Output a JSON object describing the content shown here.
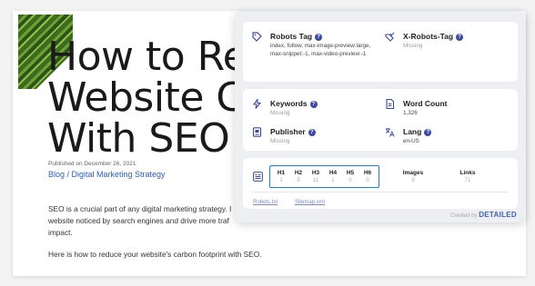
{
  "article": {
    "title_lines": [
      "How to Red",
      "Website Ca",
      "With SEO"
    ],
    "published": "Published on December 26, 2021",
    "breadcrumb": "Blog / Digital Marketing Strategy",
    "paragraph1_lines": [
      "SEO is a crucial part of any digital marketing strategy. I",
      "website noticed by search engines and drive more traf",
      "impact."
    ],
    "paragraph2": "Here is how to reduce your website's carbon footprint with SEO."
  },
  "panel": {
    "robots": {
      "label": "Robots Tag",
      "value": "index, follow, max-image-preview:large, max-snippet:-1, max-video-preview:-1",
      "icon": "tag-icon"
    },
    "x_robots": {
      "label": "X-Robots-Tag",
      "value": "Missing",
      "icon": "tag-check-icon"
    },
    "keywords": {
      "label": "Keywords",
      "value": "Missing",
      "icon": "bolt-icon"
    },
    "word_count": {
      "label": "Word Count",
      "value": "1,326",
      "icon": "document-icon"
    },
    "publisher": {
      "label": "Publisher",
      "value": "Missing",
      "icon": "badge-icon"
    },
    "lang": {
      "label": "Lang",
      "value": "en-US",
      "icon": "translate-icon"
    },
    "headings": [
      {
        "label": "H1",
        "value": "1"
      },
      {
        "label": "H2",
        "value": "5"
      },
      {
        "label": "H3",
        "value": "11"
      },
      {
        "label": "H4",
        "value": "1"
      },
      {
        "label": "H5",
        "value": "0"
      },
      {
        "label": "H6",
        "value": "0"
      }
    ],
    "images": {
      "label": "Images",
      "value": "9"
    },
    "links": {
      "label": "Links",
      "value": "71"
    },
    "robots_link": "Robots.txt",
    "sitemap_link": "Sitemap.xml",
    "credit_prefix": "Created by",
    "credit_brand": "DETAILED",
    "help_glyph": "?"
  },
  "colors": {
    "accent": "#3d4aa0",
    "highlight_border": "#1d7fd6",
    "link": "#2b5fb8",
    "brand": "#3d63b8"
  }
}
